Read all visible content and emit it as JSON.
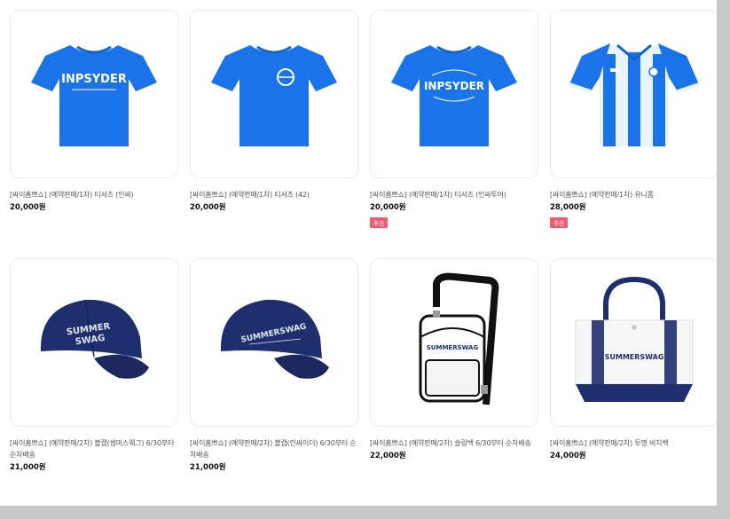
{
  "products": [
    {
      "name": "[싸이홈쁘쇼] (예약판매/1차) 티셔츠 (인싸)",
      "price": "20,000원",
      "badge": "",
      "image": "blue-tshirt-inpsyder-icon",
      "print_text": "INPSYDER"
    },
    {
      "name": "[싸이홈쁘쇼] (예약판매/1차) 티셔츠 (42)",
      "price": "20,000원",
      "badge": "",
      "image": "blue-tshirt-emblem-icon"
    },
    {
      "name": "[싸이홈쁘쇼] (예약판매/1차) 티셔츠 (인싸투어)",
      "price": "20,000원",
      "badge": "추천",
      "image": "blue-tshirt-tour-icon",
      "print_text": "INPSYDER"
    },
    {
      "name": "[싸이홈쁘쇼] (예약판매/1차) 유니폼",
      "price": "28,000원",
      "badge": "추천",
      "image": "striped-uniform-icon"
    },
    {
      "name": "[싸이홈쁘쇼] (예약판매/2차) 볼캡(썸머스웨그) 6/30부터 순차배송",
      "price": "21,000원",
      "badge": "",
      "image": "navy-cap-summer-swag-icon",
      "print_text_1": "SUMMER",
      "print_text_2": "SWAG"
    },
    {
      "name": "[싸이홈쁘쇼] (예약판매/2차) 볼캡(인싸이더) 6/30부터 순차배송",
      "price": "21,000원",
      "badge": "",
      "image": "navy-cap-summerswag-icon",
      "print_text": "SUMMERSWAG"
    },
    {
      "name": "[싸이홈쁘쇼] (예약판매/2차) 슬링백 6/30부터 순차배송",
      "price": "22,000원",
      "badge": "",
      "image": "sling-bag-icon",
      "print_text": "SUMMERSWAG"
    },
    {
      "name": "[싸이홈쁘쇼] (예약판매/2차) 투명 비치백",
      "price": "24,000원",
      "badge": "",
      "image": "clear-tote-bag-icon",
      "print_text": "SUMMERSWAG"
    }
  ],
  "colors": {
    "accent_blue": "#1a73e8",
    "navy": "#1f2f6e",
    "badge": "#f05a73"
  }
}
